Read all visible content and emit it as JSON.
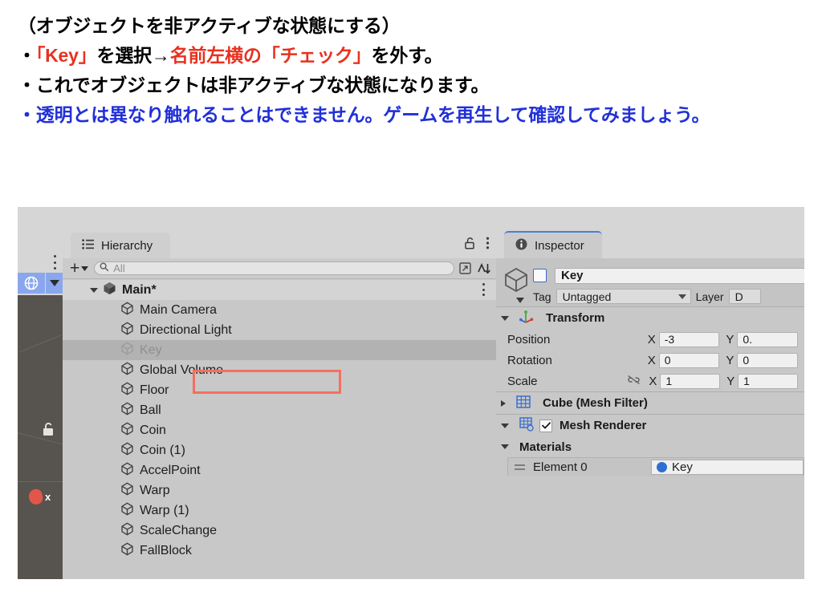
{
  "slide": {
    "lines": [
      [
        {
          "t": "（オブジェクトを非アクティブな状態にする）",
          "c": "black"
        }
      ],
      [
        {
          "t": "・",
          "c": "black"
        },
        {
          "t": "「Key」",
          "c": "red"
        },
        {
          "t": "を選択→",
          "c": "black"
        },
        {
          "t": "名前左横の「チェック」",
          "c": "red"
        },
        {
          "t": "を外す。",
          "c": "black"
        }
      ],
      [
        {
          "t": "・これでオブジェクトは非アクティブな状態になります。",
          "c": "black"
        }
      ],
      [
        {
          "t": "・透明とは異なり触れることはできません。ゲームを再生して確認してみましょう。",
          "c": "blue"
        }
      ]
    ],
    "colors": {
      "red": "#e8311f",
      "blue": "#2130d8",
      "black": "#000000"
    }
  },
  "editor": {
    "toolbar_icons": [
      "cloud-icon",
      "history-icon"
    ],
    "scene_view": {
      "gizmo_button": "orientation-gizmo-icon",
      "gizmo_dropdown": "chevron-down-icon",
      "lock_icon": "unlocked-padlock-icon",
      "axis_label": "x",
      "overflow_menu": "kebab-menu-icon"
    },
    "hierarchy": {
      "tab_label": "Hierarchy",
      "tab_icon": "hierarchy-list-icon",
      "lock_icon": "unlocked-padlock-icon",
      "menu_icon": "kebab-menu-icon",
      "add_button_label": "+",
      "search_placeholder": "All",
      "search_icon": "search-icon",
      "save_search_icon": "save-search-icon",
      "sort_icon": "sort-icon",
      "scene_root": "Main*",
      "items": [
        {
          "label": "Main Camera",
          "state": "active"
        },
        {
          "label": "Directional Light",
          "state": "active"
        },
        {
          "label": "Key",
          "state": "inactive",
          "selected": true
        },
        {
          "label": "Global Volume",
          "state": "active"
        },
        {
          "label": "Floor",
          "state": "active"
        },
        {
          "label": "Ball",
          "state": "active"
        },
        {
          "label": "Coin",
          "state": "active"
        },
        {
          "label": "Coin (1)",
          "state": "active"
        },
        {
          "label": "AccelPoint",
          "state": "active"
        },
        {
          "label": "Warp",
          "state": "active"
        },
        {
          "label": "Warp (1)",
          "state": "active"
        },
        {
          "label": "ScaleChange",
          "state": "active"
        },
        {
          "label": "FallBlock",
          "state": "active"
        }
      ]
    },
    "inspector": {
      "tab_label": "Inspector",
      "tab_icon": "info-icon",
      "object_icon": "prefab-cube-icon",
      "object_name": "Key",
      "active_checkbox_checked": false,
      "tag_label": "Tag",
      "tag_value": "Untagged",
      "layer_label": "Layer",
      "layer_value": "D",
      "transform": {
        "title": "Transform",
        "icon": "transform-axes-icon",
        "rows": [
          {
            "label": "Position",
            "x_letter": "X",
            "x": "-3",
            "y_letter": "Y",
            "y": "0."
          },
          {
            "label": "Rotation",
            "x_letter": "X",
            "x": "0",
            "y_letter": "Y",
            "y": "0"
          },
          {
            "label": "Scale",
            "x_letter": "X",
            "x": "1",
            "y_letter": "Y",
            "y": "1",
            "link_icon": "constrain-proportions-off-icon"
          }
        ]
      },
      "components": [
        {
          "title": "Cube (Mesh Filter)",
          "icon": "mesh-filter-icon",
          "expanded": false,
          "has_checkbox": false
        },
        {
          "title": "Mesh Renderer",
          "icon": "mesh-renderer-icon",
          "expanded": true,
          "has_checkbox": true,
          "checked": true
        }
      ],
      "materials": {
        "title": "Materials",
        "element_label": "Element 0",
        "element_value": "Key",
        "element_icon": "material-sphere-icon"
      }
    },
    "annotations": {
      "box_color": "#f4705e",
      "boxes": [
        "hierarchy-key-row",
        "inspector-name-field"
      ]
    }
  }
}
